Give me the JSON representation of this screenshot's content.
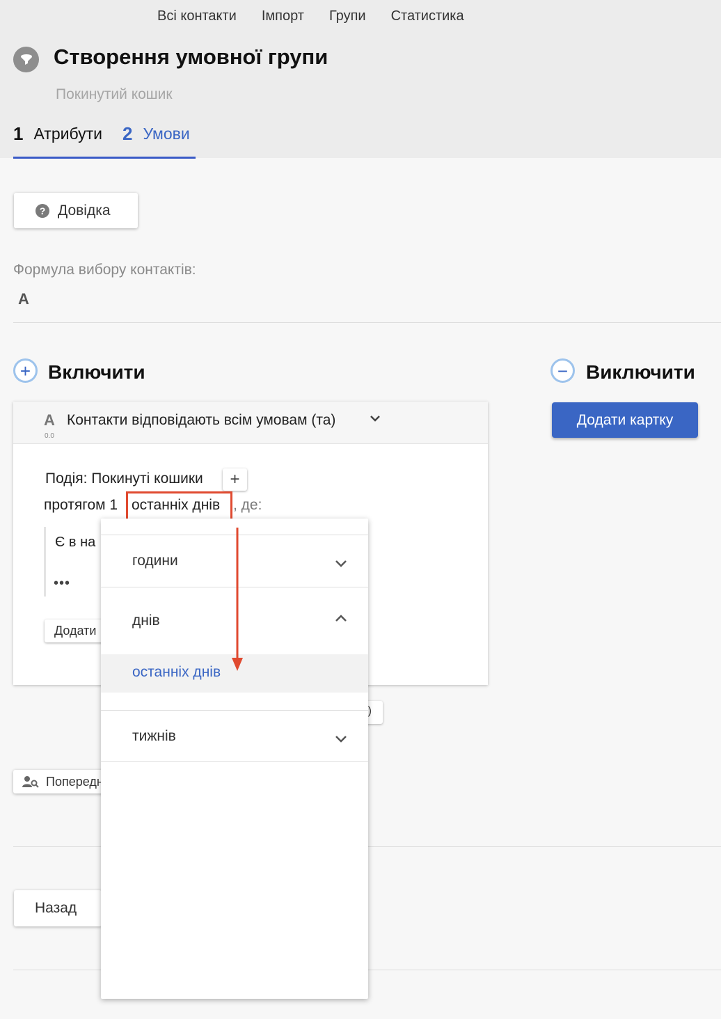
{
  "nav": {
    "items": [
      {
        "label": "Всі контакти"
      },
      {
        "label": "Імпорт"
      },
      {
        "label": "Групи"
      },
      {
        "label": "Статистика"
      }
    ]
  },
  "page": {
    "title": "Створення умовної групи",
    "subtitle": "Покинутий кошик"
  },
  "steps": [
    {
      "number": "1",
      "label": "Атрибути"
    },
    {
      "number": "2",
      "label": "Умови"
    }
  ],
  "help_button": {
    "label": "Довідка"
  },
  "formula": {
    "label": "Формула вибору контактів:",
    "value": "A"
  },
  "include": {
    "title": "Включити",
    "icon": "+"
  },
  "exclude": {
    "title": "Виключити",
    "icon": "−",
    "add_card_label": "Додати картку"
  },
  "card": {
    "letter": "A",
    "version": "0.0",
    "condition": "Контакти відповідають всім умовам (та)",
    "event": "Подія: Покинуті кошики",
    "period_prefix": "протягом 1",
    "period_value": "останніх днів",
    "period_suffix": ", де:",
    "inner_text": "Є в на",
    "inner_dots": "•••",
    "add_label": "Додати"
  },
  "partial_button": {
    "label": ")"
  },
  "preview_button": {
    "label": "Попередн"
  },
  "back_button": {
    "label": "Назад"
  },
  "dropdown": {
    "groups": [
      {
        "label": "години",
        "expanded": false
      },
      {
        "label": "днів",
        "expanded": true
      },
      {
        "label": "тижнів",
        "expanded": false
      }
    ],
    "selected_option": "останніх днів"
  },
  "colors": {
    "accent": "#3a66c4",
    "highlight": "#e04a30",
    "header_bg": "#ececec"
  }
}
